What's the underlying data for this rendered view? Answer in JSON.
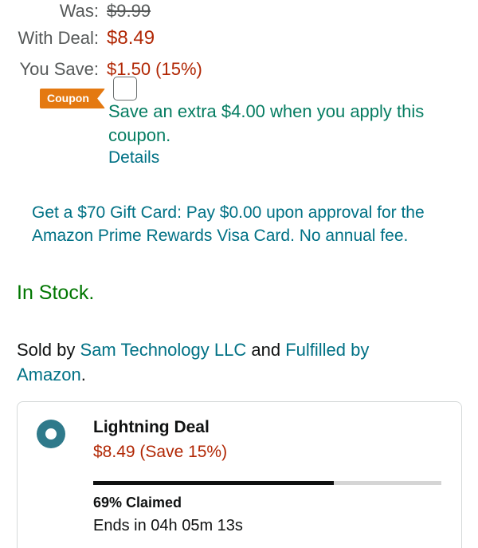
{
  "pricing": {
    "was_label": "Was:",
    "was_value": "$9.99",
    "deal_label": "With Deal:",
    "deal_value": "$8.49",
    "save_label": "You Save:",
    "save_value": "$1.50 (15%)"
  },
  "coupon": {
    "badge": "Coupon",
    "text": "Save an extra $4.00 when you apply this coupon.",
    "details": "Details"
  },
  "gift_card": {
    "text": "Get a $70 Gift Card: Pay $0.00 upon approval for the Amazon Prime Rewards Visa Card. No annual fee."
  },
  "stock": {
    "text": "In Stock."
  },
  "seller": {
    "prefix": "Sold by",
    "seller_name": "Sam Technology LLC",
    "and": "and",
    "fulfilled": "Fulfilled by Amazon",
    "suffix": "."
  },
  "lightning_deal": {
    "title": "Lightning Deal",
    "price": "$8.49 (Save 15%)",
    "claimed_percent": 69,
    "claimed_text": "69% Claimed",
    "ends_text": "Ends in 04h 05m 13s"
  },
  "colors": {
    "price_red": "#b12704",
    "link_teal": "#007185",
    "coupon_green": "#067d62",
    "stock_green": "#007600",
    "coupon_orange": "#e47911",
    "radio_teal": "#2f7a8b"
  }
}
